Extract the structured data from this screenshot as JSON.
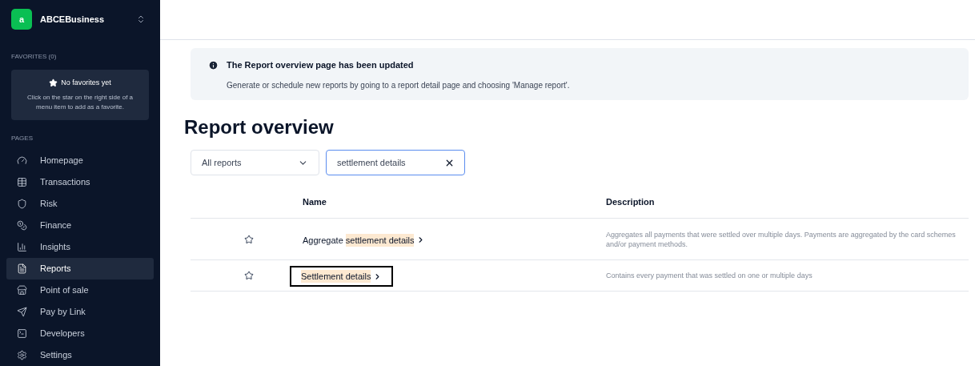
{
  "sidebar": {
    "account": {
      "logo": "a",
      "name": "ABCEBusiness"
    },
    "favorites": {
      "heading": "FAVORITES (0)",
      "empty_title": "No favorites yet",
      "empty_text": "Click on the star on the right side of a menu item to add as a favorite."
    },
    "pages_heading": "PAGES",
    "items": [
      {
        "label": "Homepage",
        "selected": false
      },
      {
        "label": "Transactions",
        "selected": false
      },
      {
        "label": "Risk",
        "selected": false
      },
      {
        "label": "Finance",
        "selected": false
      },
      {
        "label": "Insights",
        "selected": false
      },
      {
        "label": "Reports",
        "selected": true
      },
      {
        "label": "Point of sale",
        "selected": false
      },
      {
        "label": "Pay by Link",
        "selected": false
      },
      {
        "label": "Developers",
        "selected": false
      },
      {
        "label": "Settings",
        "selected": false
      }
    ]
  },
  "banner": {
    "title": "The Report overview page has been updated",
    "text": "Generate or schedule new reports by going to a report detail page and choosing 'Manage report'."
  },
  "page_title": "Report overview",
  "filters": {
    "report_type": "All reports",
    "search": "settlement details"
  },
  "table": {
    "columns": [
      "Name",
      "Description"
    ],
    "rows": [
      {
        "name": [
          {
            "text": "Aggregate ",
            "highlighted": false
          },
          {
            "text": "settlement details",
            "highlighted": true
          }
        ],
        "description": "Aggregates all payments that were settled over multiple days. Payments are aggregated by the card schemes and/or payment methods.",
        "focused": false
      },
      {
        "name": [
          {
            "text": "Settlement details",
            "highlighted": true
          }
        ],
        "description": "Contains every payment that was settled on one or multiple days",
        "focused": true
      }
    ]
  }
}
